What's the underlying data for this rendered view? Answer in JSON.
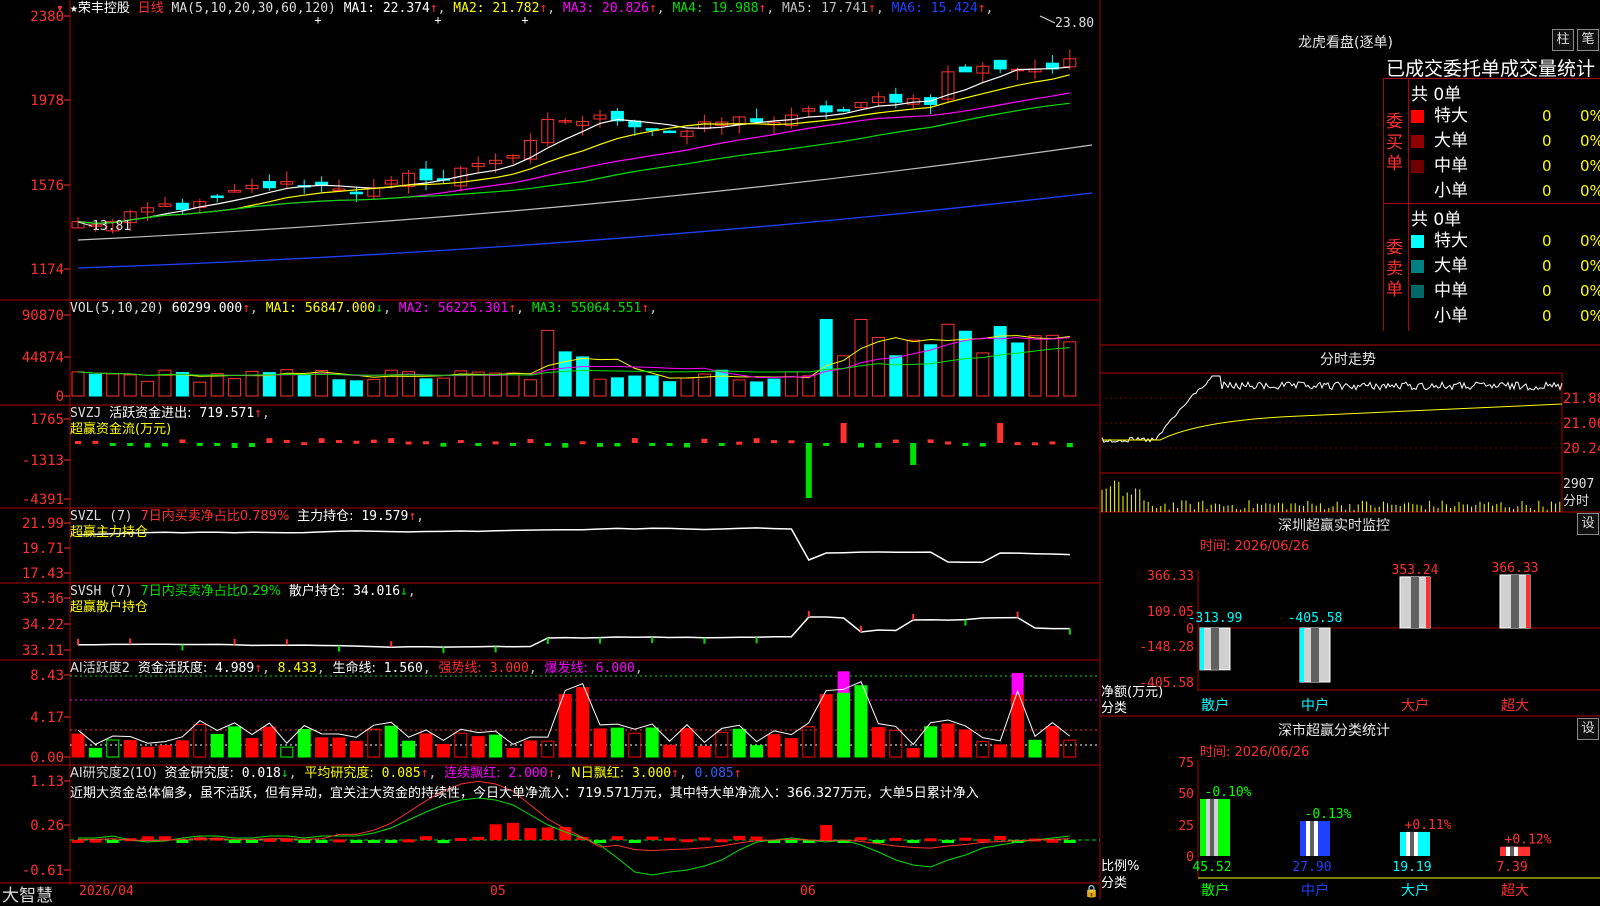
{
  "main_chart": {
    "stock_name": "荣丰控股",
    "period": "日线",
    "ma_label": "MA(5,10,20,30,60,120)",
    "ma": [
      {
        "label": "MA1:",
        "value": "22.374",
        "arrow": "↑",
        "color": "#ffffff"
      },
      {
        "label": "MA2:",
        "value": "21.782",
        "arrow": "↑",
        "color": "#ffff00"
      },
      {
        "label": "MA3:",
        "value": "20.826",
        "arrow": "↑",
        "color": "#ff00ff"
      },
      {
        "label": "MA4:",
        "value": "19.988",
        "arrow": "↑",
        "color": "#00e000"
      },
      {
        "label": "MA5:",
        "value": "17.741",
        "arrow": "↑",
        "color": "#c0c0c0"
      },
      {
        "label": "MA6:",
        "value": "15.424",
        "arrow": "↑",
        "color": "#2040ff"
      }
    ],
    "y_ticks": [
      "2380",
      "1978",
      "1576",
      "1174"
    ],
    "high_mark": "23.80",
    "low_mark": "13.81"
  },
  "vol_panel": {
    "label": "VOL(5,10,20)",
    "value": "60299.000",
    "ma": [
      {
        "label": "MA1:",
        "value": "56847.000",
        "arrow": "↓",
        "color": "#ffff00"
      },
      {
        "label": "MA2:",
        "value": "56225.301",
        "arrow": "↑",
        "color": "#ff00ff"
      },
      {
        "label": "MA3:",
        "value": "55064.551",
        "arrow": "↑",
        "color": "#00e000"
      }
    ],
    "y_ticks": [
      "90870",
      "44874",
      "0"
    ]
  },
  "svzj_panel": {
    "label": "SVZJ",
    "item": "活跃资金进出:",
    "value": "719.571",
    "arrow": "↑",
    "subtitle": "超赢资金流(万元)",
    "y_ticks": [
      "1765",
      "-1313",
      "-4391"
    ]
  },
  "svzl_panel": {
    "label": "SVZL (7)",
    "ratio": "7日内买卖净占比0.789%",
    "item": "主力持仓:",
    "value": "19.579",
    "arrow": "↑",
    "subtitle": "超赢主力持仓",
    "y_ticks": [
      "21.99",
      "19.71",
      "17.43"
    ]
  },
  "svsh_panel": {
    "label": "SVSH (7)",
    "ratio": "7日内买卖净占比0.29%",
    "item": "散户持仓:",
    "value": "34.016",
    "arrow": "↓",
    "subtitle": "超赢散户持仓",
    "y_ticks": [
      "35.36",
      "34.22",
      "33.11"
    ]
  },
  "ai_active_panel": {
    "label": "AI活跃度2",
    "item1": "资金活跃度:",
    "v1": "4.989",
    "a1": "↑",
    "v2": "8.433",
    "item3": "生命线:",
    "v3": "1.560",
    "item4": "强势线:",
    "v4": "3.000",
    "item5": "爆发线:",
    "v5": "6.000",
    "y_ticks": [
      "8.43",
      "4.17",
      "0.00"
    ]
  },
  "ai_research_panel": {
    "label": "AI研究度2(10)",
    "item1": "资金研究度:",
    "v1": "0.018",
    "a1": "↓",
    "item2": "平均研究度:",
    "v2": "0.085",
    "a2": "↑",
    "item3": "连续飘红:",
    "v3": "2.000",
    "a3": "↑",
    "item4": "N日飘红:",
    "v4": "3.000",
    "a4": "↑",
    "v5": "0.085",
    "a5": "↑",
    "comment": "近期大资金总体偏多，虽不活跃，但有异动，宜关注大资金的持续性，今日大单净流入：719.571万元，其中特大单净流入：366.327万元，大单5日累计净入",
    "y_ticks": [
      "1.13",
      "0.26",
      "-0.61"
    ]
  },
  "bottom_bar": {
    "brand": "大智慧",
    "date_label": "2026/04",
    "month_labels": [
      "05",
      "06"
    ]
  },
  "longhu": {
    "title": "龙虎看盘(逐单)",
    "btn_bar": "柱",
    "btn_pen": "笔",
    "header": "已成交委托单成交量统计",
    "buy_side": "委买单",
    "sell_side": "委卖单",
    "buy_total": "共 0单",
    "sell_total": "共 0单",
    "buy_rows": [
      {
        "name": "特大",
        "count": "0",
        "pct": "0%",
        "color": "#ff0000"
      },
      {
        "name": "大单",
        "count": "0",
        "pct": "0%",
        "color": "#900000"
      },
      {
        "name": "中单",
        "count": "0",
        "pct": "0%",
        "color": "#700000"
      },
      {
        "name": "小单",
        "count": "0",
        "pct": "0%",
        "color": ""
      }
    ],
    "sell_rows": [
      {
        "name": "特大",
        "count": "0",
        "pct": "0%",
        "color": "#00ffff"
      },
      {
        "name": "大单",
        "count": "0",
        "pct": "0%",
        "color": "#008080"
      },
      {
        "name": "中单",
        "count": "0",
        "pct": "0%",
        "color": "#006868"
      },
      {
        "name": "小单",
        "count": "0",
        "pct": "0%",
        "color": ""
      }
    ]
  },
  "intraday": {
    "title": "分时走势",
    "y_ticks": [
      "21.88",
      "21.06",
      "20.24"
    ],
    "vol_tick": "2907",
    "vol_label": "分时"
  },
  "sz_realtime": {
    "title": "深圳超赢实时监控",
    "btn": "设",
    "time_label": "时间: 2026/06/26",
    "y_ticks": [
      "366.33",
      "109.05",
      "0",
      "-148.28",
      "-405.58"
    ],
    "ylabel": "净额(万元)",
    "xlabel": "分类",
    "chart_data": {
      "type": "bar",
      "categories": [
        "散户",
        "中户",
        "大户",
        "超大"
      ],
      "values": [
        -313.99,
        -405.58,
        353.24,
        366.33
      ],
      "value_labels": [
        "-313.99",
        "-405.58",
        "353.24",
        "366.33"
      ],
      "ylim": [
        -405.58,
        366.33
      ]
    }
  },
  "sz_class": {
    "title": "深市超赢分类统计",
    "btn": "设",
    "time_label": "时间: 2026/06/26",
    "y_ticks": [
      "75",
      "50",
      "25",
      "0"
    ],
    "ylabel": "比例%",
    "xlabel": "分类",
    "chart_data": {
      "type": "bar",
      "categories": [
        "散户",
        "中户",
        "大户",
        "超大"
      ],
      "values": [
        45.52,
        27.9,
        19.19,
        7.39
      ],
      "value_labels": [
        "45.52",
        "27.90",
        "19.19",
        "7.39"
      ],
      "change_labels": [
        "-0.10%",
        "-0.13%",
        "+0.11%",
        "+0.12%"
      ],
      "ylim": [
        0,
        75
      ]
    }
  }
}
